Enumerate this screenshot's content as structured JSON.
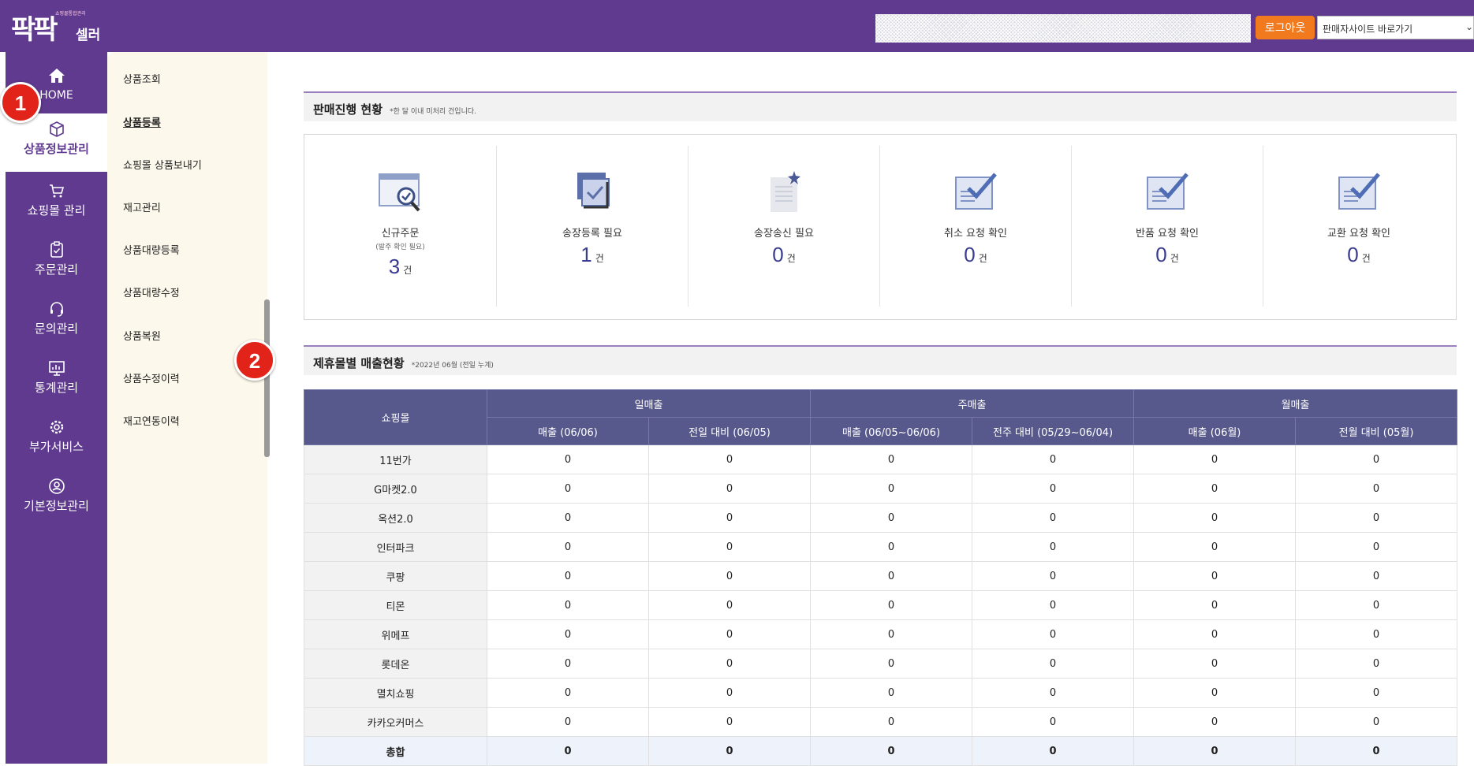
{
  "header": {
    "logo_small": "쇼핑몰통합관리",
    "logo_main": "팍팍",
    "logo_sub": "셀러",
    "logout_label": "로그아웃",
    "site_select_value": "판매자사이트 바로가기"
  },
  "nav": {
    "items": [
      {
        "label": "HOME"
      },
      {
        "label": "상품정보관리"
      },
      {
        "label": "쇼핑몰 관리"
      },
      {
        "label": "주문관리"
      },
      {
        "label": "문의관리"
      },
      {
        "label": "통계관리"
      },
      {
        "label": "부가서비스"
      },
      {
        "label": "기본정보관리"
      }
    ]
  },
  "badges": [
    "1",
    "2"
  ],
  "submenu": {
    "items": [
      "상품조회",
      "상품등록",
      "쇼핑몰 상품보내기",
      "재고관리",
      "상품대량등록",
      "상품대량수정",
      "상품복원",
      "상품수정이력",
      "재고연동이력"
    ]
  },
  "sales_status": {
    "title": "판매진행 현황",
    "note": "*한 달 이내 미처리 건입니다.",
    "cards": [
      {
        "label": "신규주문",
        "note": "(발주 확인 필요)",
        "count": "3",
        "unit": "건"
      },
      {
        "label": "송장등록 필요",
        "note": "",
        "count": "1",
        "unit": "건"
      },
      {
        "label": "송장송신 필요",
        "note": "",
        "count": "0",
        "unit": "건"
      },
      {
        "label": "취소 요청 확인",
        "note": "",
        "count": "0",
        "unit": "건"
      },
      {
        "label": "반품 요청 확인",
        "note": "",
        "count": "0",
        "unit": "건"
      },
      {
        "label": "교환 요청 확인",
        "note": "",
        "count": "0",
        "unit": "건"
      }
    ]
  },
  "mall_sales": {
    "title": "제휴몰별 매출현황",
    "note": "*2022년 06월 (전일 누계)",
    "header_mall": "쇼핑몰",
    "groups": [
      "일매출",
      "주매출",
      "월매출"
    ],
    "columns": [
      "매출 (06/06)",
      "전일 대비 (06/05)",
      "매출 (06/05~06/06)",
      "전주 대비 (05/29~06/04)",
      "매출 (06월)",
      "전월 대비 (05월)"
    ],
    "rows": [
      {
        "mall": "11번가",
        "values": [
          "0",
          "0",
          "0",
          "0",
          "0",
          "0"
        ]
      },
      {
        "mall": "G마켓2.0",
        "values": [
          "0",
          "0",
          "0",
          "0",
          "0",
          "0"
        ]
      },
      {
        "mall": "옥션2.0",
        "values": [
          "0",
          "0",
          "0",
          "0",
          "0",
          "0"
        ]
      },
      {
        "mall": "인터파크",
        "values": [
          "0",
          "0",
          "0",
          "0",
          "0",
          "0"
        ]
      },
      {
        "mall": "쿠팡",
        "values": [
          "0",
          "0",
          "0",
          "0",
          "0",
          "0"
        ]
      },
      {
        "mall": "티몬",
        "values": [
          "0",
          "0",
          "0",
          "0",
          "0",
          "0"
        ]
      },
      {
        "mall": "위메프",
        "values": [
          "0",
          "0",
          "0",
          "0",
          "0",
          "0"
        ]
      },
      {
        "mall": "롯데온",
        "values": [
          "0",
          "0",
          "0",
          "0",
          "0",
          "0"
        ]
      },
      {
        "mall": "멸치쇼핑",
        "values": [
          "0",
          "0",
          "0",
          "0",
          "0",
          "0"
        ]
      },
      {
        "mall": "카카오커머스",
        "values": [
          "0",
          "0",
          "0",
          "0",
          "0",
          "0"
        ]
      }
    ],
    "total": {
      "mall": "총합",
      "values": [
        "0",
        "0",
        "0",
        "0",
        "0",
        "0"
      ]
    }
  },
  "colors": {
    "brand_purple": "#5f3a8e",
    "logout_orange": "#f27a1e",
    "table_header": "#57588c",
    "badge_red": "#e2231a",
    "count_blue": "#3a3d8f"
  }
}
